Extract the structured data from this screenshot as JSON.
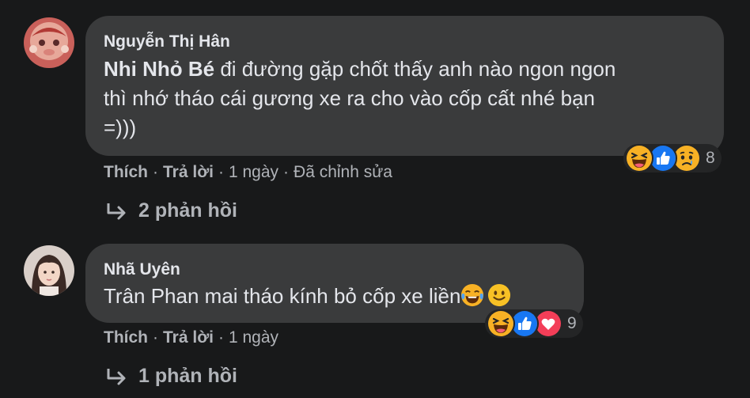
{
  "comments": [
    {
      "author": "Nguyễn Thị Hân",
      "mention": "Nhi Nhỏ Bé",
      "text_line1": " đi đường gặp chốt thấy anh nào ngon ngon",
      "text_line2": "thì nhớ tháo cái gương xe ra cho vào cốp cất nhé bạn",
      "text_line3": "=)))",
      "reaction_icons": [
        "haha-icon",
        "like-icon",
        "sad-icon"
      ],
      "reaction_count": "8",
      "like_label": "Thích",
      "reply_label": "Trả lời",
      "time": "1 ngày",
      "edited": "Đã chỉnh sửa",
      "replies_label": "2 phản hồi"
    },
    {
      "author": "Nhã Uyên",
      "text": "Trân Phan mai tháo kính bỏ cốp xe liền",
      "inline_emojis": [
        "tears-of-joy-emoji",
        "slightly-smiling-emoji"
      ],
      "reaction_icons": [
        "haha-icon",
        "like-icon",
        "love-icon"
      ],
      "reaction_count": "9",
      "like_label": "Thích",
      "reply_label": "Trả lời",
      "time": "1 ngày",
      "replies_label": "1 phản hồi"
    }
  ],
  "colors": {
    "background": "#18191a",
    "bubble": "#3a3b3c",
    "primary_text": "#e4e6eb",
    "secondary_text": "#b0b3b8",
    "like_blue": "#1877f2",
    "love_red": "#f33e58",
    "emoji_yellow": "#f7b125"
  }
}
